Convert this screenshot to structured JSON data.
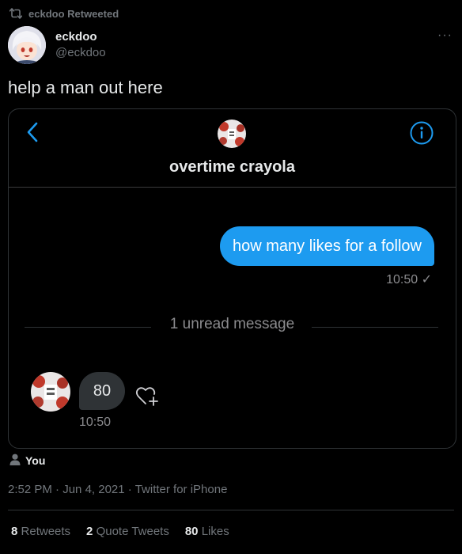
{
  "retweet_banner": {
    "text": "eckdoo Retweeted",
    "icon": "retweet-icon"
  },
  "author": {
    "display_name": "eckdoo",
    "handle": "@eckdoo"
  },
  "more_menu": {
    "label": "···"
  },
  "tweet": {
    "text": "help a man out here"
  },
  "screenshot": {
    "chat_name": "overtime crayola",
    "sent_message": {
      "text": "how many likes for a follow",
      "time": "10:50 ✓"
    },
    "unread_divider": "1 unread message",
    "received_message": {
      "text": "80",
      "time": "10:50"
    },
    "colors": {
      "sent_bubble": "#1d9bf0",
      "received_bubble": "#2f3336",
      "accent": "#1d9bf0"
    }
  },
  "tagged": {
    "label": "You",
    "icon": "person-icon"
  },
  "meta": {
    "time": "2:52 PM",
    "sep1": "·",
    "date": "Jun 4, 2021",
    "sep2": "·",
    "source": "Twitter for iPhone"
  },
  "stats": {
    "retweets": {
      "count": "8",
      "label": "Retweets"
    },
    "quote_tweets": {
      "count": "2",
      "label": "Quote Tweets"
    },
    "likes": {
      "count": "80",
      "label": "Likes"
    }
  }
}
